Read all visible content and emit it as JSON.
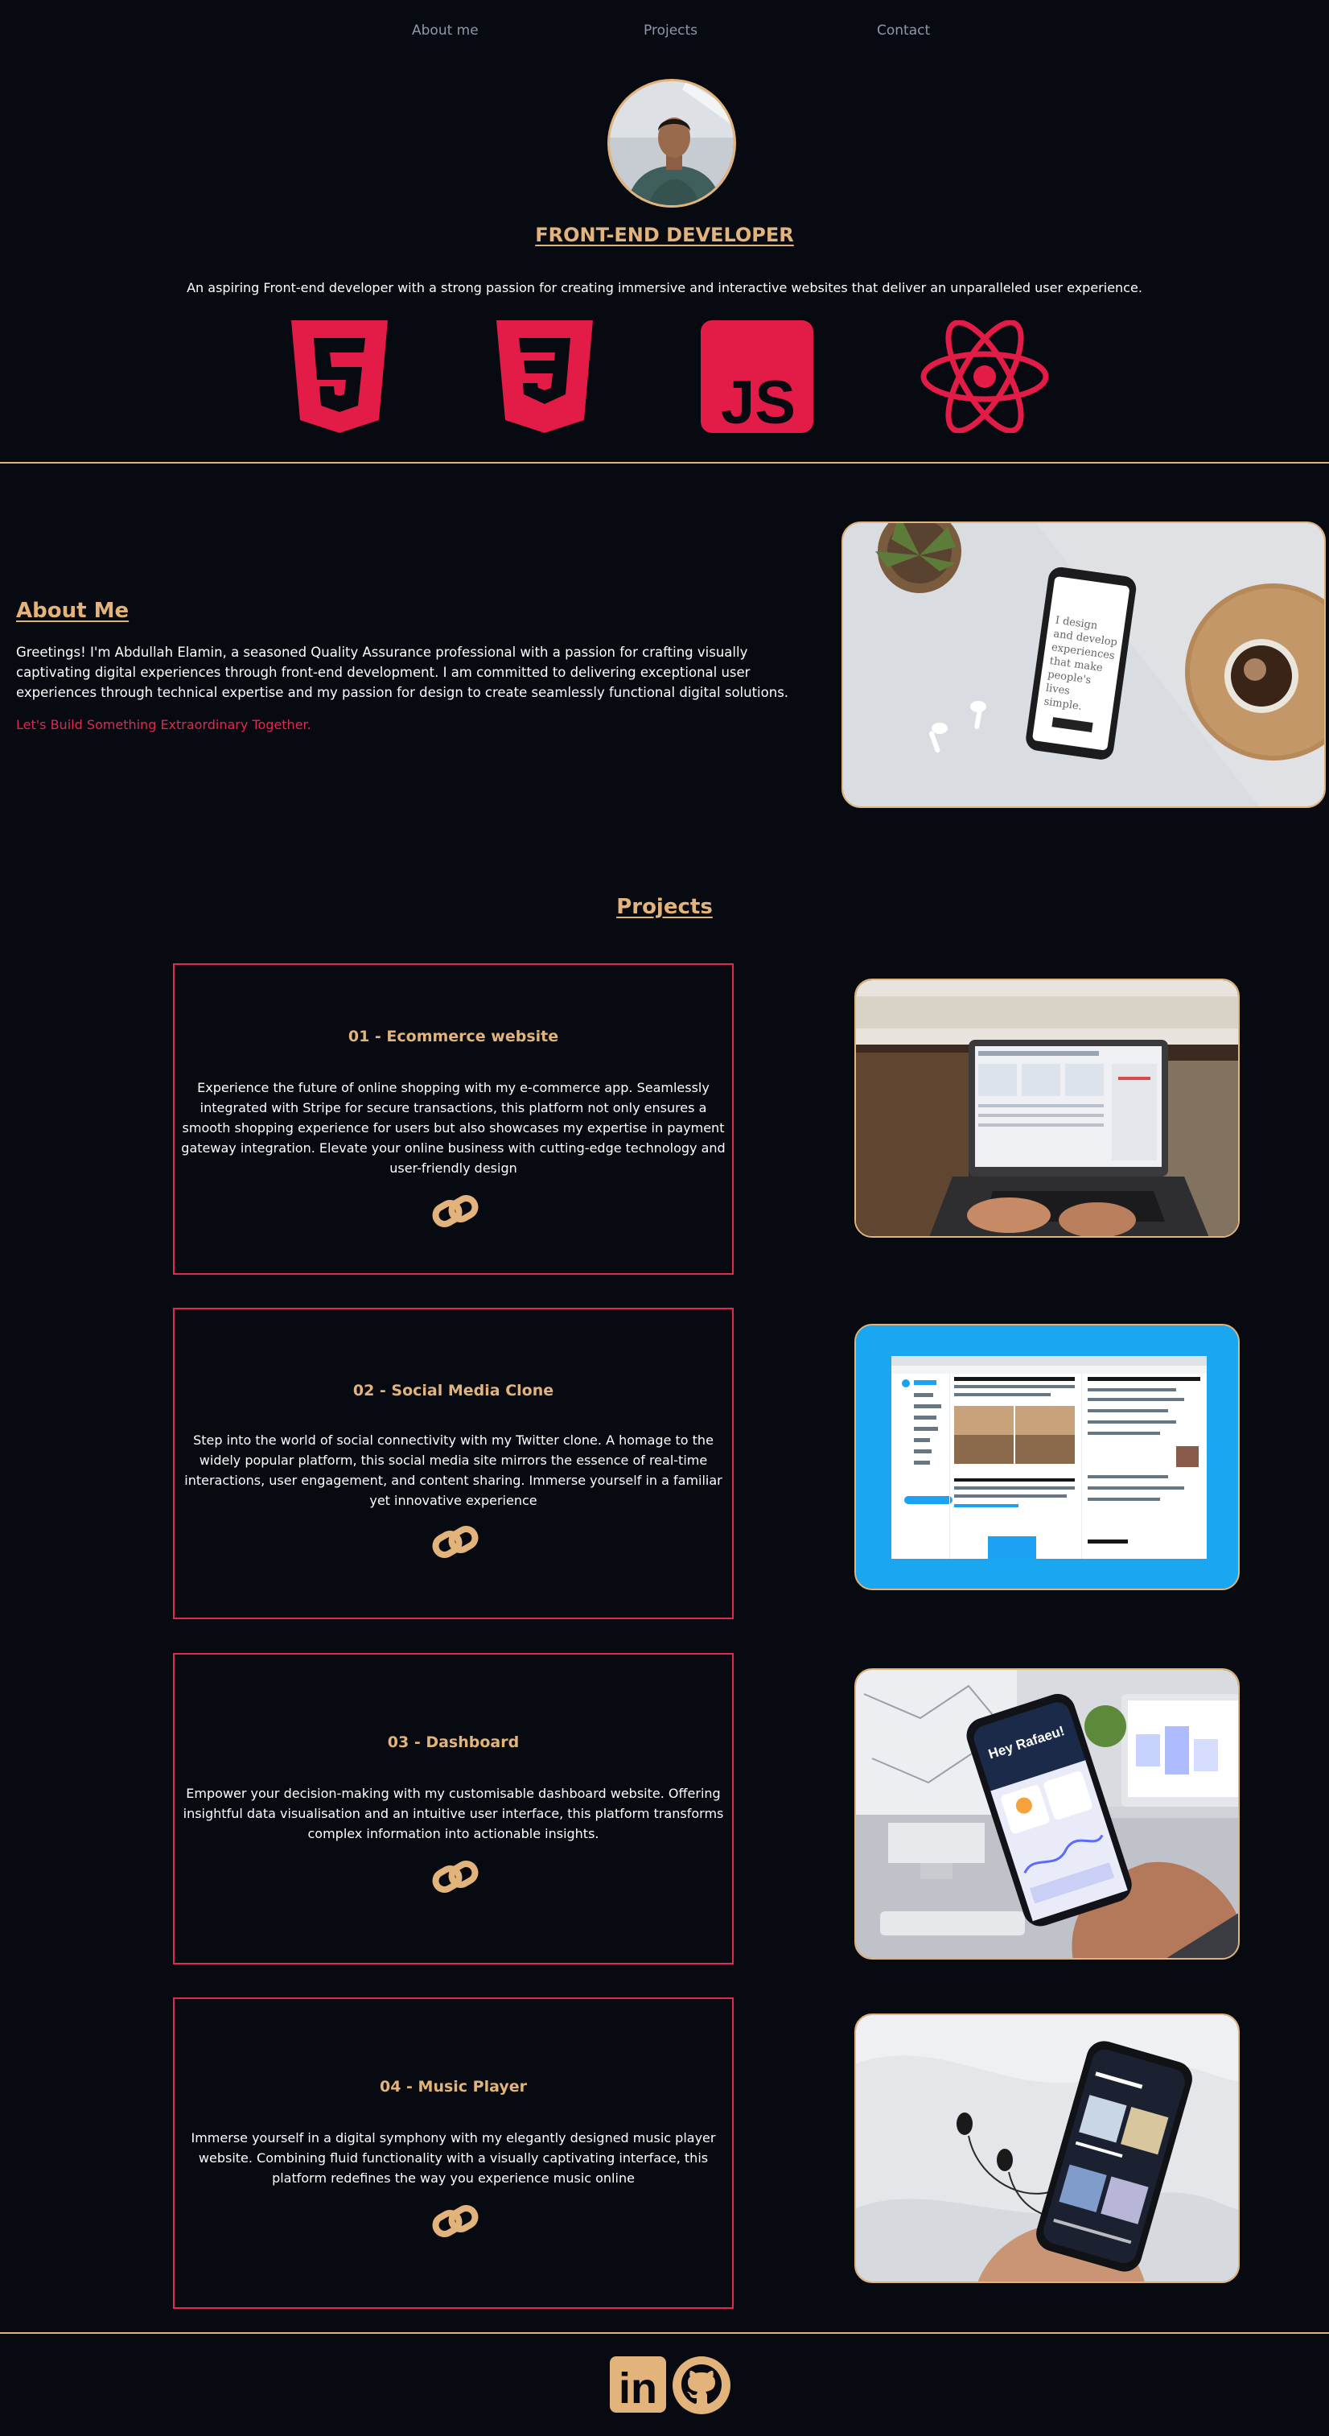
{
  "nav": {
    "items": [
      {
        "label": "About me"
      },
      {
        "label": "Projects"
      },
      {
        "label": "Contact"
      }
    ]
  },
  "hero": {
    "title": "FRONT-END DEVELOPER",
    "subtitle": "An aspiring Front-end developer with a strong passion for creating immersive and interactive websites that deliver an unparalleled user experience.",
    "tech_icons": [
      "html5-icon",
      "css3-icon",
      "javascript-icon",
      "react-icon"
    ],
    "js_badge_text": "JS"
  },
  "about": {
    "title": "About Me",
    "body": "Greetings! I'm Abdullah Elamin, a seasoned Quality Assurance professional with a passion for crafting visually captivating digital experiences through front-end development. I am committed to delivering exceptional user experiences through technical expertise and my passion for design to create seamlessly functional digital solutions.",
    "cta": "Let's Build Something Extraordinary Together.",
    "phone_screen_text": "I design and develop experiences that make people's lives simple."
  },
  "projects": {
    "title": "Projects",
    "items": [
      {
        "title": "01 - Ecommerce website",
        "description": "Experience the future of online shopping with my e-commerce app. Seamlessly integrated with Stripe for secure transactions, this platform not only ensures a smooth shopping experience for users but also showcases my expertise in payment gateway integration. Elevate your online business with cutting-edge technology and user-friendly design"
      },
      {
        "title": "02 - Social Media Clone",
        "description": "Step into the world of social connectivity with my Twitter clone. A homage to the widely popular platform, this social media site mirrors the essence of real-time interactions, user engagement, and content sharing. Immerse yourself in a familiar yet innovative experience"
      },
      {
        "title": "03 - Dashboard",
        "description": "Empower your decision-making with my customisable dashboard website. Offering insightful data visualisation and an intuitive user interface, this platform transforms complex information into actionable insights."
      },
      {
        "title": "04 - Music Player",
        "description": "Immerse yourself in a digital symphony with my elegantly designed music player website. Combining fluid functionality with a visually captivating interface, this platform redefines the way you experience music online"
      }
    ],
    "dashboard_phone_text": "Hey Rafaeu!"
  },
  "footer": {
    "icons": [
      "linkedin-icon",
      "github-icon"
    ],
    "linkedin_text": "in"
  },
  "colors": {
    "background": "#080a12",
    "accent": "#e2b37a",
    "brand_red": "#e0294f",
    "nav_text": "#8f98a8",
    "twitter_blue": "#1da1f2"
  }
}
